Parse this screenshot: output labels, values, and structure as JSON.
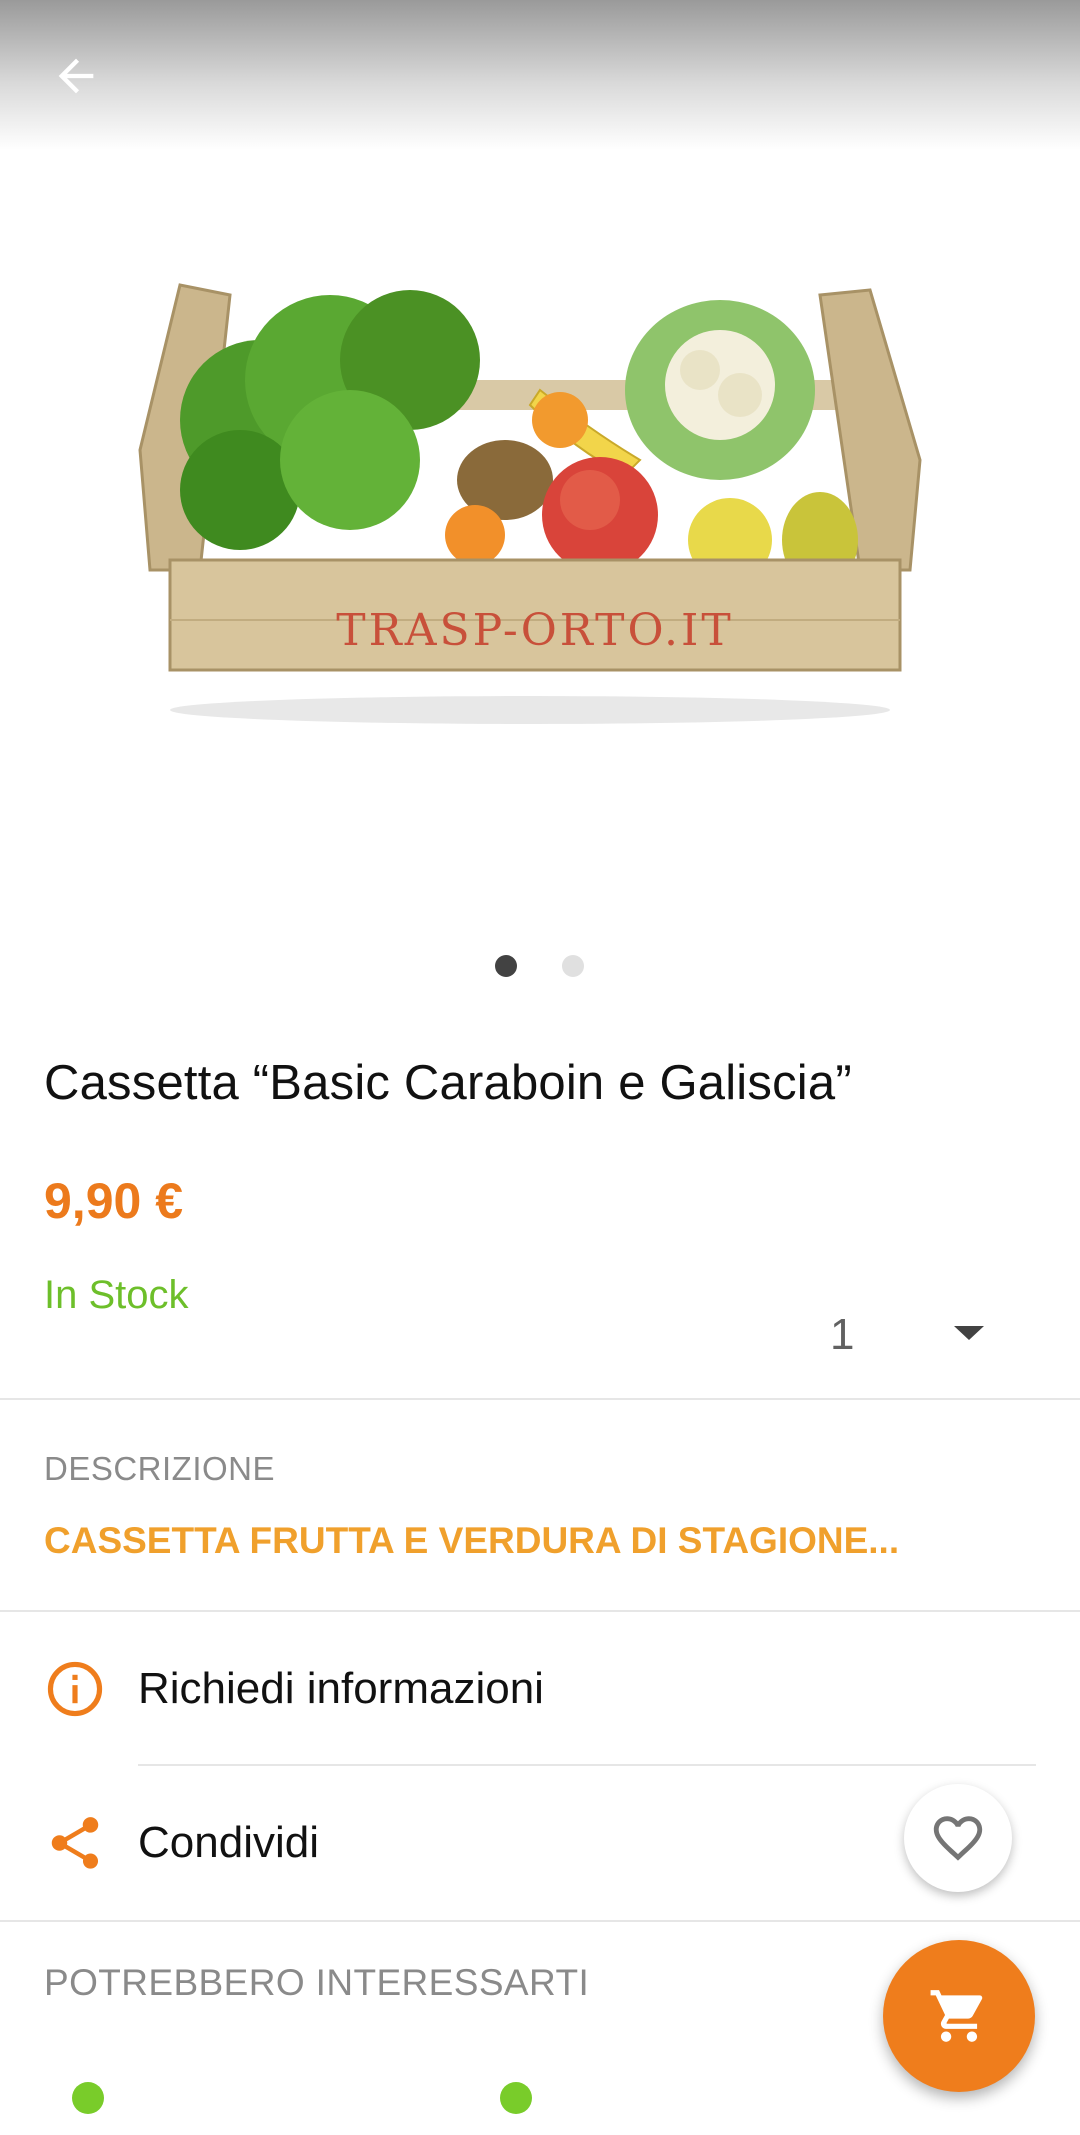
{
  "product": {
    "title": "Cassetta “Basic Caraboin e Galiscia”",
    "price": "9,90 €",
    "stock_status": "In Stock",
    "quantity": "1",
    "image_crate_text": "TRASP-ORTO.IT",
    "image_count": 2,
    "image_active_index": 0
  },
  "description": {
    "label": "DESCRIZIONE",
    "text": "CASSETTA FRUTTA E VERDURA DI STAGIONE..."
  },
  "actions": {
    "request_info_label": "Richiedi informazioni",
    "share_label": "Condividi"
  },
  "related": {
    "label": "POTREBBERO INTERESSARTI"
  },
  "icons": {
    "back": "arrow-back-icon",
    "info": "info-icon",
    "share": "share-icon",
    "favorite": "heart-outline-icon",
    "cart": "shopping-cart-icon",
    "dropdown": "caret-down-icon"
  },
  "colors": {
    "accent_orange": "#ef7d1c",
    "price_orange": "#ec7a1c",
    "description_orange": "#f0a02c",
    "stock_green": "#6dbf2a",
    "related_dot_green": "#79cc2a"
  }
}
